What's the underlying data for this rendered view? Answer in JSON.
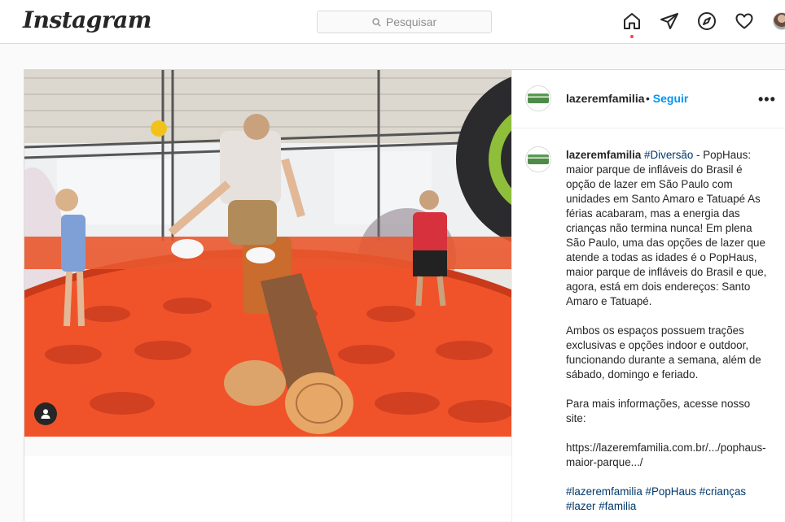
{
  "app": {
    "logo": "Instagram"
  },
  "search": {
    "placeholder": "Pesquisar"
  },
  "nav": [
    "home-icon",
    "direct-icon",
    "explore-icon",
    "activity-icon",
    "profile-avatar"
  ],
  "post": {
    "username": "lazeremfamilia",
    "follow_label": "Seguir",
    "separator": "•",
    "more_label": "•••",
    "caption": {
      "username": "lazeremfamilia",
      "hashtag_first": "#Diversão",
      "paragraph1_rest": " - PopHaus: maior parque de infláveis do Brasil é opção de lazer em São Paulo com unidades em Santo Amaro e Tatuapé As férias acabaram, mas a energia das crianças não termina nunca! Em plena São Paulo, uma das opções de lazer que atende a todas as idades é o PopHaus, maior parque de infláveis do Brasil e que, agora, está em dois endereços: Santo Amaro e Tatuapé.",
      "paragraph2": "Ambos os espaços possuem trações exclusivas e opções indoor e outdoor, funcionando durante a semana, além de sábado, domingo e feriado.",
      "paragraph3": "Para mais informações, acesse nosso site:",
      "link": "https://lazeremfamilia.com.br/.../pophaus-maior-parque.../",
      "hashtags": [
        "#lazeremfamilia",
        "#PopHaus",
        "#crianças",
        "#lazer",
        "#familia"
      ]
    }
  },
  "colors": {
    "link_blue": "#0095f6",
    "hashtag": "#00376b",
    "notif_dot": "#ed4956",
    "inflatable": "#f0532a"
  }
}
